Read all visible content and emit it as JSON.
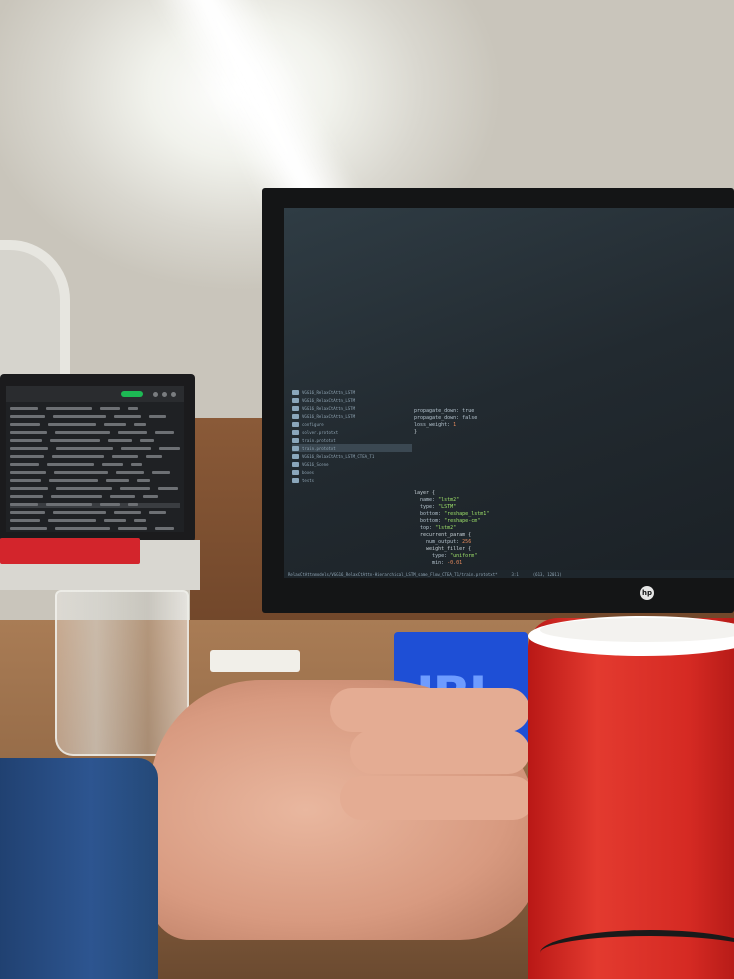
{
  "scene": {
    "description_tags": [
      "office-desk",
      "code-editor-monitor",
      "laptop-music-player",
      "jbl-speaker",
      "red-mug",
      "hand-on-mouse"
    ]
  },
  "monitor": {
    "brand_logo": "hp",
    "code_lines": [
      {
        "text": "layer {"
      },
      {
        "text": "  name: \"lstm2\""
      },
      {
        "text": "  type: \"LSTM\""
      },
      {
        "text": "  bottom: \"reshape_lstm1\""
      },
      {
        "text": "  bottom: \"reshape-cm\""
      },
      {
        "text": "  top: \"lstm2\""
      },
      {
        "text": "  recurrent_param {"
      },
      {
        "text": "    num_output: 256"
      },
      {
        "text": "    weight_filler {"
      },
      {
        "text": "      type: \"uniform\""
      },
      {
        "text": "      min: -0.01"
      }
    ],
    "upper_code_lines": [
      {
        "text": "propagate_down: true"
      },
      {
        "text": "propagate_down: false"
      },
      {
        "text": "loss_weight: 1"
      },
      {
        "text": "}"
      }
    ],
    "filetree": [
      {
        "label": "VGG16_RelaxCtAttn_LSTM"
      },
      {
        "label": "VGG16_RelaxCtAttn_LSTM"
      },
      {
        "label": "VGG16_RelaxCtAttn_LSTM"
      },
      {
        "label": "VGG16_RelaxCtAttn_LSTM"
      },
      {
        "label": "configure"
      },
      {
        "label": "solver.prototxt"
      },
      {
        "label": "train.prototxt"
      },
      {
        "label": "train.prototxt"
      },
      {
        "label": "VGG16_RelaxCtAttn_LSTM_CTEA_T1"
      },
      {
        "label": "VGG16_Scene"
      },
      {
        "label": "boxes"
      },
      {
        "label": "tests"
      }
    ],
    "statusbar": {
      "path": "RelaxCtAttnmodels/VGG16_RelaxCtAttn-Hierarchical_LSTM_same_Flow_CTEA_T1/train.prototxt*",
      "position": "3:1",
      "size": "(613, 12011)"
    }
  },
  "laptop": {
    "app": "music-player",
    "play_button_color": "#1db954"
  },
  "speaker": {
    "logo": "JBL",
    "color": "#1e4fd6"
  },
  "mug": {
    "color": "#d52a23"
  }
}
